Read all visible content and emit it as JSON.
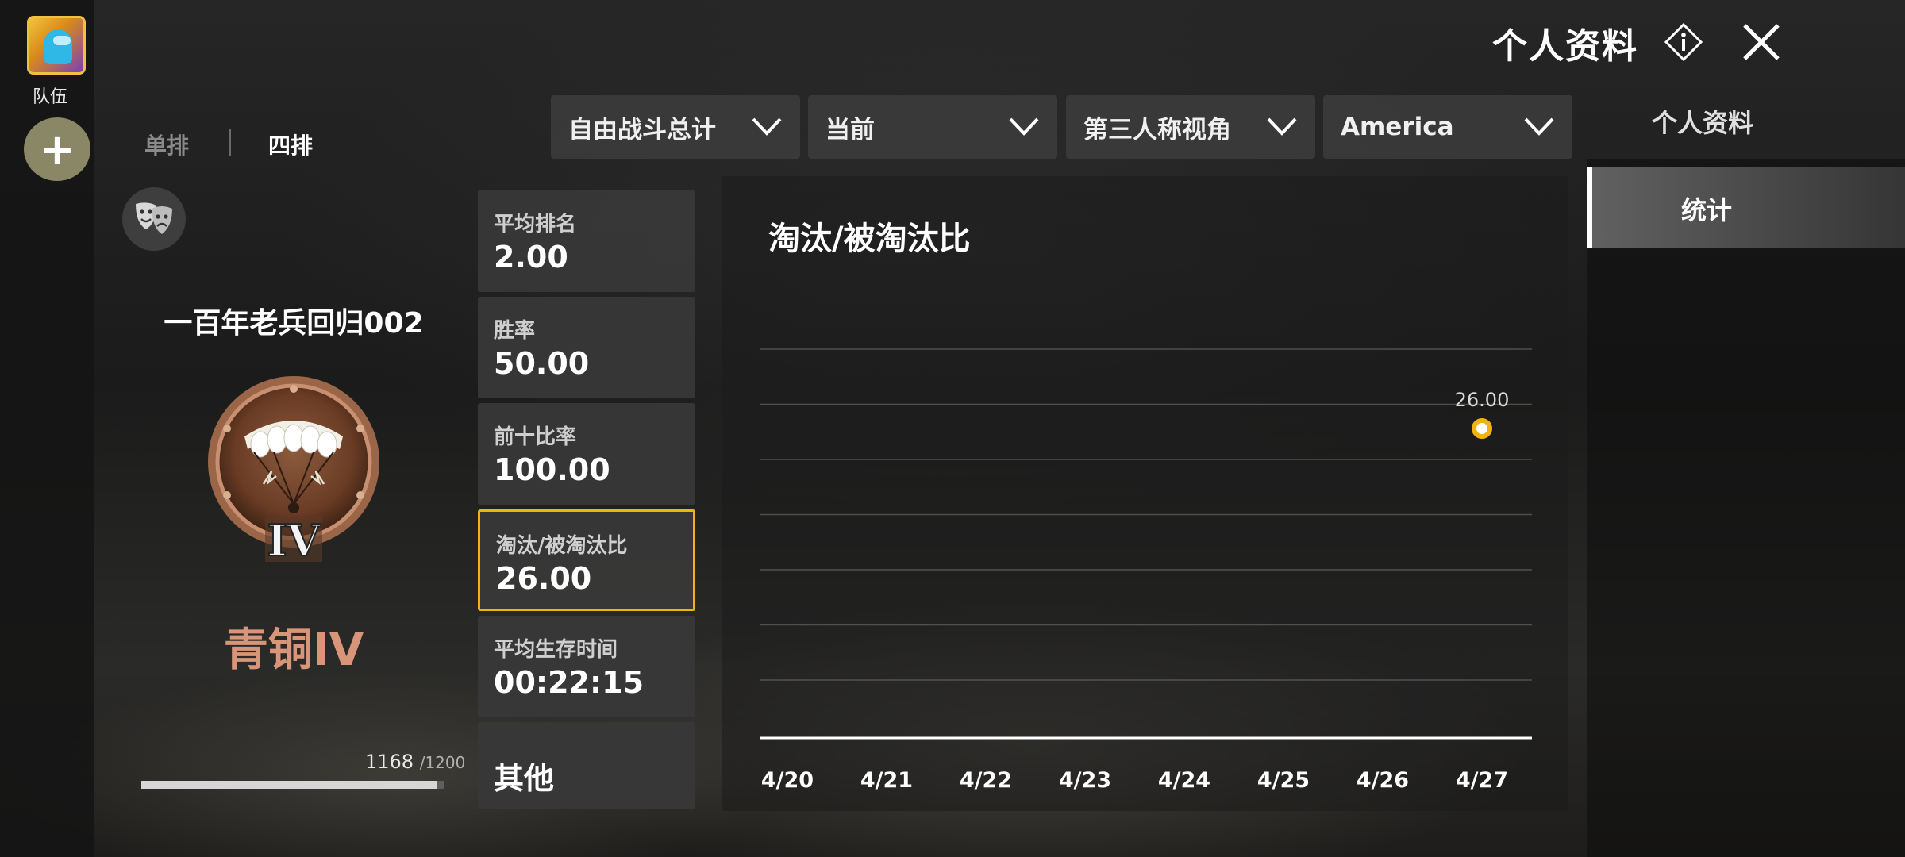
{
  "team": {
    "label": "队伍",
    "add": "+"
  },
  "header": {
    "title": "个人资料"
  },
  "mode_tabs": {
    "solo": "单排",
    "squad": "四排"
  },
  "filters": {
    "mode": "自由战斗总计",
    "season": "当前",
    "perspective": "第三人称视角",
    "region": "America"
  },
  "right_nav": {
    "title": "个人资料",
    "active": "统计"
  },
  "profile": {
    "name": "一百年老兵回归002",
    "rank": "青铜IV",
    "rank_roman": "IV",
    "xp": "1168",
    "xp_max": "/1200",
    "xp_fraction": 0.973
  },
  "stats": [
    {
      "label": "平均排名",
      "value": "2.00"
    },
    {
      "label": "胜率",
      "value": "50.00"
    },
    {
      "label": "前十比率",
      "value": "100.00"
    },
    {
      "label": "淘汰/被淘汰比",
      "value": "26.00"
    },
    {
      "label": "平均生存时间",
      "value": "00:22:15"
    },
    {
      "label": "其他"
    }
  ],
  "colors": {
    "accent": "#f0b310",
    "rank": "#d9957a"
  },
  "chart_data": {
    "type": "scatter",
    "title": "淘汰/被淘汰比",
    "categories": [
      "4/20",
      "4/21",
      "4/22",
      "4/23",
      "4/24",
      "4/25",
      "4/26",
      "4/27"
    ],
    "series": [
      {
        "values": [
          null,
          null,
          null,
          null,
          null,
          null,
          null,
          26.0
        ],
        "labels": [
          "",
          "",
          "",
          "",
          "",
          "",
          "",
          "26.00"
        ]
      }
    ],
    "ylim": [
      0,
      40
    ],
    "grid": true
  }
}
